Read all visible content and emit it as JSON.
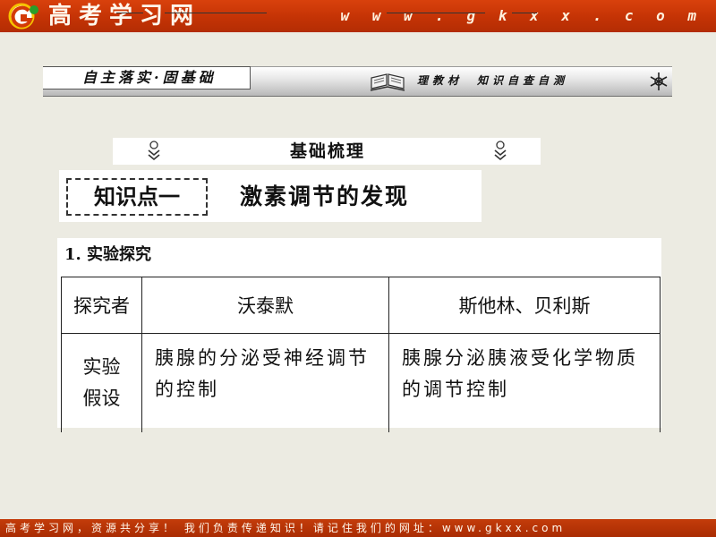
{
  "header": {
    "brand": "高考学习网",
    "url": "w w w . g k x x . c o m",
    "colors": {
      "bar": "#c43305",
      "text": "#fff7ec"
    },
    "logo_icon": "gk-logo-icon"
  },
  "banner": {
    "left_label": "自主落实·固基础",
    "right_label_1": "理教材",
    "right_label_2": "知识自查自测",
    "book_icon": "open-book-icon",
    "flake_icon": "snowflake-icon"
  },
  "section_strip": {
    "title": "基础梳理",
    "deco_icon": "chevron-down-icon"
  },
  "knowledge_point": {
    "label": "知识点一",
    "title": "激素调节的发现"
  },
  "content": {
    "heading": "1. 实验探究",
    "table": {
      "headers": [
        "探究者",
        "沃泰默",
        "斯他林、贝利斯"
      ],
      "rows": [
        {
          "label_line1": "实验",
          "label_line2": "假设",
          "col1": "胰腺的分泌受神经调节的控制",
          "col2": "胰腺分泌胰液受化学物质的调节控制"
        }
      ]
    }
  },
  "footer": {
    "text": "高考学习网，资源共分享！ 我们负责传递知识！请记住我们的网址：www.gkxx.com"
  }
}
